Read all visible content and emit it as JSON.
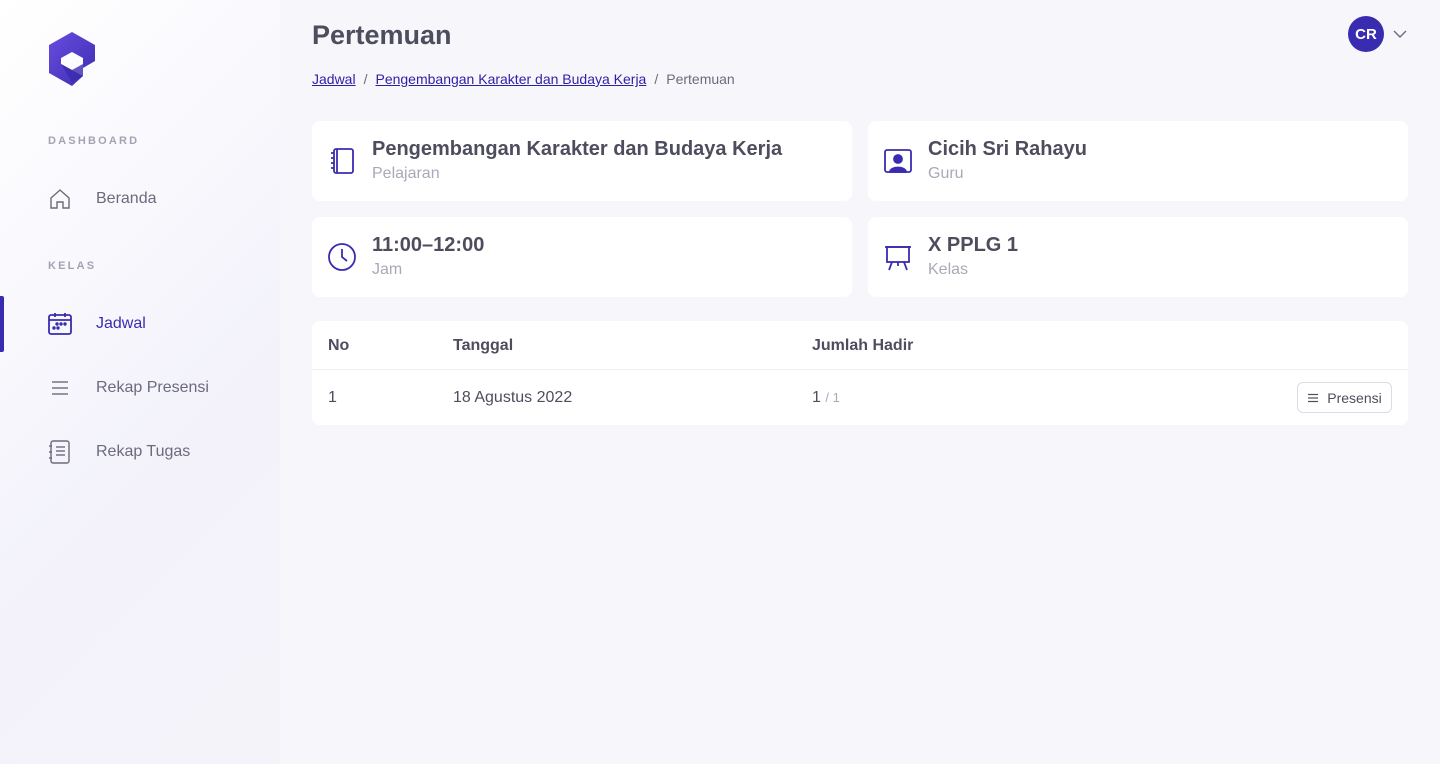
{
  "sidebar": {
    "sections": [
      {
        "label": "DASHBOARD"
      },
      {
        "label": "KELAS"
      }
    ],
    "items": [
      {
        "label": "Beranda",
        "icon": "home-icon"
      },
      {
        "label": "Jadwal",
        "icon": "calendar-icon",
        "active": true
      },
      {
        "label": "Rekap Presensi",
        "icon": "list-icon"
      },
      {
        "label": "Rekap Tugas",
        "icon": "document-list-icon"
      }
    ]
  },
  "header": {
    "title": "Pertemuan",
    "breadcrumb": [
      {
        "label": "Jadwal",
        "link": true
      },
      {
        "label": "Pengembangan Karakter dan Budaya Kerja",
        "link": true
      },
      {
        "label": "Pertemuan",
        "link": false
      }
    ],
    "breadcrumb_separator": "/",
    "avatar_initials": "CR"
  },
  "cards": [
    {
      "title": "Pengembangan Karakter dan Budaya Kerja",
      "subtitle": "Pelajaran",
      "icon": "book-icon"
    },
    {
      "title": "Cicih Sri Rahayu",
      "subtitle": "Guru",
      "icon": "teacher-icon"
    },
    {
      "title": "11:00–12:00",
      "subtitle": "Jam",
      "icon": "clock-icon"
    },
    {
      "title": "X PPLG 1",
      "subtitle": "Kelas",
      "icon": "board-icon"
    }
  ],
  "table": {
    "columns": [
      "No",
      "Tanggal",
      "Jumlah Hadir"
    ],
    "rows": [
      {
        "no": "1",
        "tanggal": "18 Agustus 2022",
        "hadir": "1",
        "total": "/ 1",
        "action_label": "Presensi"
      }
    ]
  },
  "colors": {
    "accent": "#3a2cb0",
    "background": "#f7f7fb"
  }
}
